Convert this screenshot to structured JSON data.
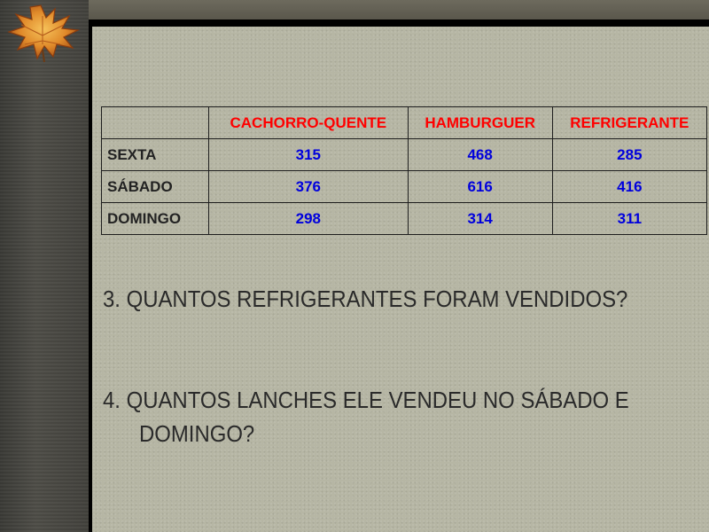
{
  "table": {
    "columns": [
      "CACHORRO-QUENTE",
      "HAMBURGUER",
      "REFRIGERANTE"
    ],
    "rows": [
      {
        "label": "SEXTA",
        "values": [
          "315",
          "468",
          "285"
        ]
      },
      {
        "label": "SÁBADO",
        "values": [
          "376",
          "616",
          "416"
        ]
      },
      {
        "label": "DOMINGO",
        "values": [
          "298",
          "314",
          "311"
        ]
      }
    ]
  },
  "questions": {
    "q3": "3.   QUANTOS REFRIGERANTES FORAM VENDIDOS?",
    "q4_line1": "4.  QUANTOS LANCHES ELE VENDEU NO SÁBADO E",
    "q4_line2": "DOMINGO?"
  },
  "colors": {
    "column_header": "#ff0000",
    "value": "#0000dd",
    "slide_background": "#b6b6a4"
  },
  "icons": {
    "corner": "maple-leaf-icon"
  }
}
